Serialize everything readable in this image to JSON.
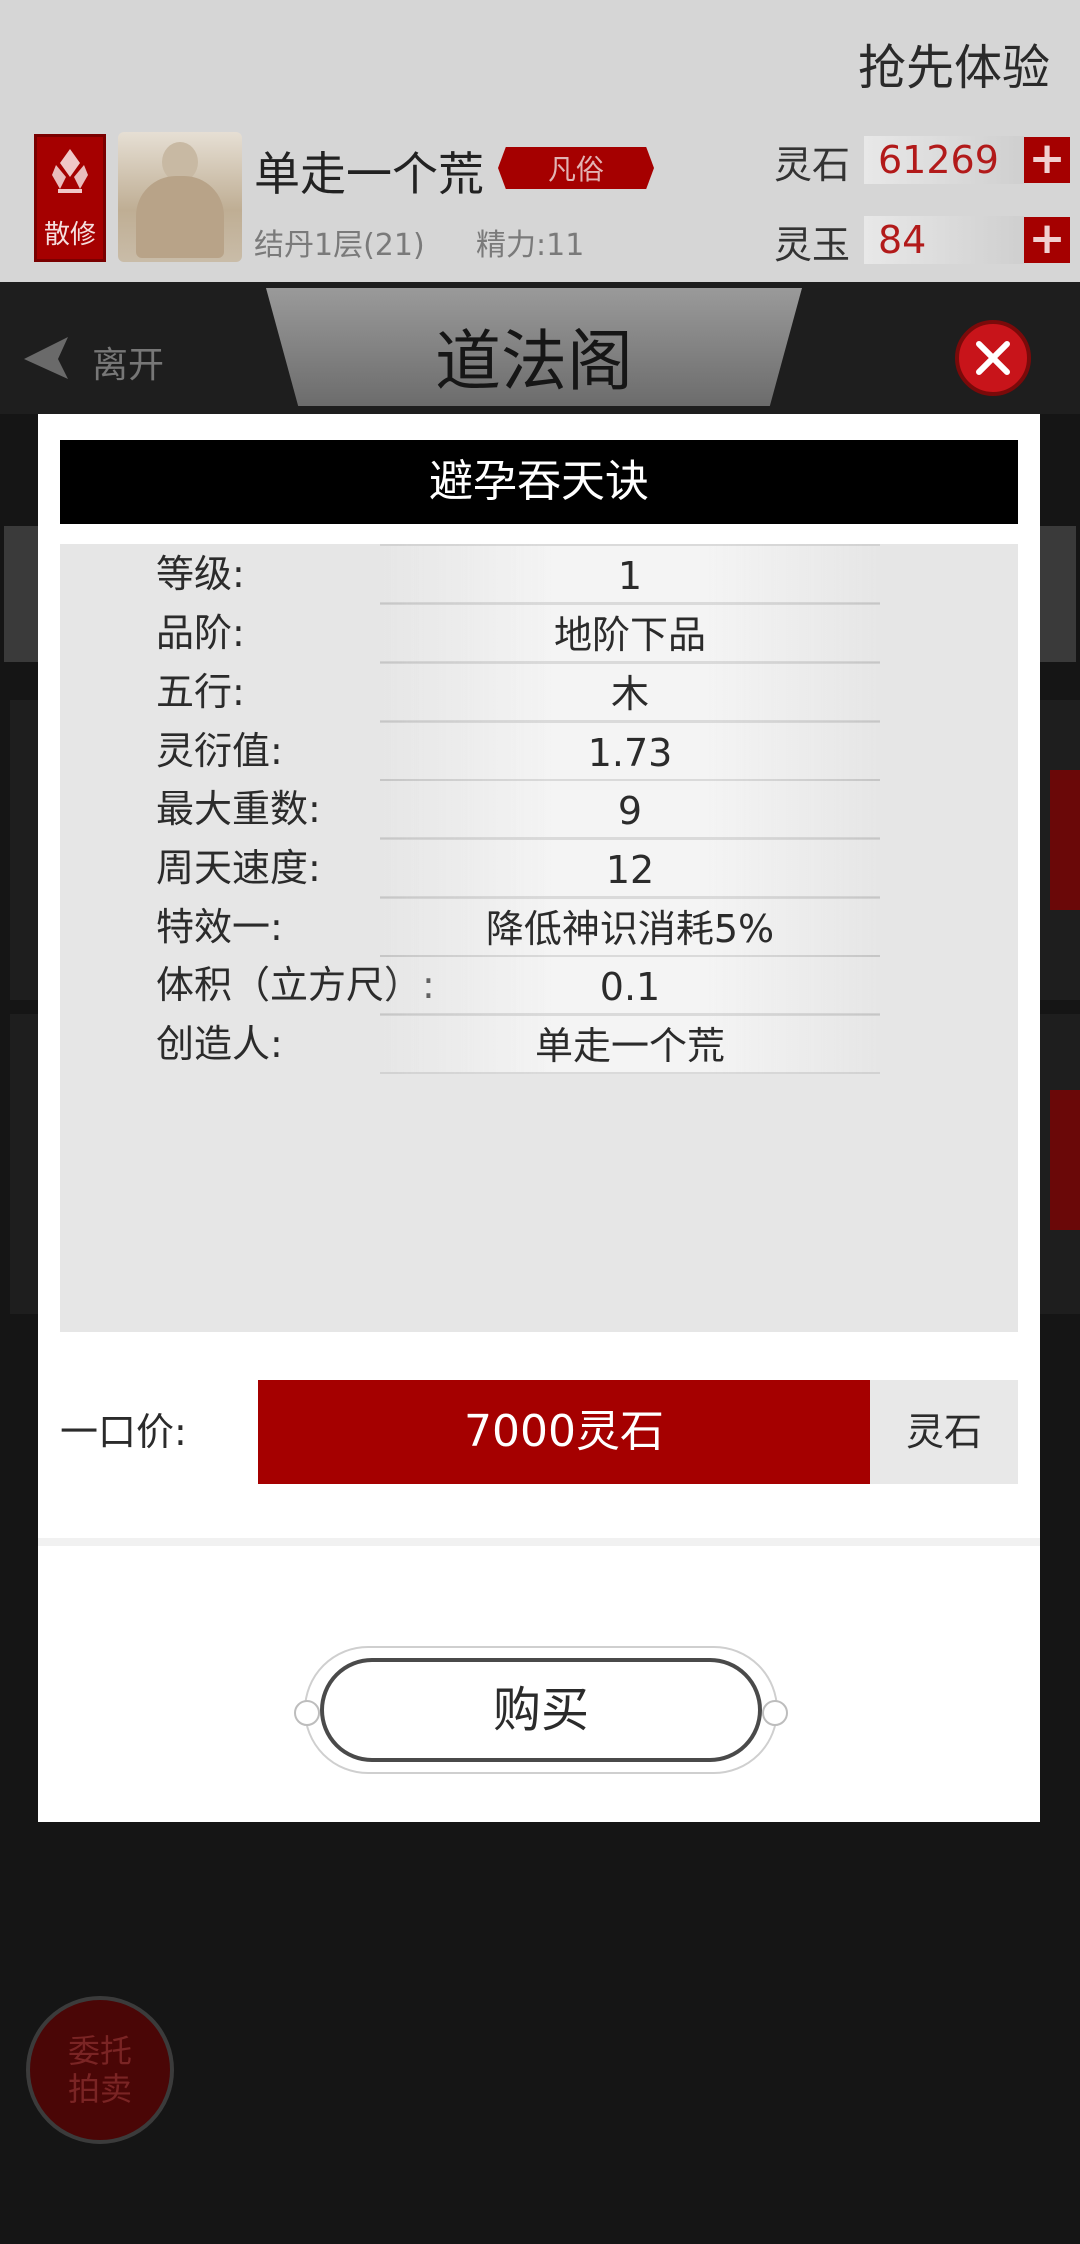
{
  "header": {
    "trial_text": "抢先体验",
    "badge_label": "散修",
    "character_name": "单走一个荒",
    "rank_tag": "凡俗",
    "level_text": "结丹1层(21)",
    "energy_text": "精力:11",
    "resources": [
      {
        "label": "灵石",
        "value": "61269"
      },
      {
        "label": "灵玉",
        "value": "84"
      }
    ]
  },
  "nav": {
    "leave_label": "离开",
    "title": "道法阁"
  },
  "background": {
    "commission_line1": "委托",
    "commission_line2": "拍卖"
  },
  "modal": {
    "title": "避孕吞天诀",
    "properties": [
      {
        "label": "等级:",
        "value": "1"
      },
      {
        "label": "品阶:",
        "value": "地阶下品"
      },
      {
        "label": "五行:",
        "value": "木"
      },
      {
        "label": "灵衍值:",
        "value": "1.73"
      },
      {
        "label": "最大重数:",
        "value": "9"
      },
      {
        "label": "周天速度:",
        "value": "12"
      },
      {
        "label": "特效一:",
        "value": "降低神识消耗5%"
      },
      {
        "label": "体积（立方尺）:",
        "value": "0.1"
      },
      {
        "label": "创造人:",
        "value": "单走一个荒"
      }
    ],
    "price_label": "一口价:",
    "price_value": "7000灵石",
    "price_currency": "灵石",
    "buy_label": "购买"
  },
  "icons": {
    "close": "close-icon",
    "back": "back-arrow-icon",
    "plus": "plus-icon",
    "lotus": "lotus-icon"
  },
  "colors": {
    "accent_red": "#a50000",
    "close_red": "#c8141a",
    "modal_bg": "#ffffff",
    "header_black": "#000000"
  }
}
